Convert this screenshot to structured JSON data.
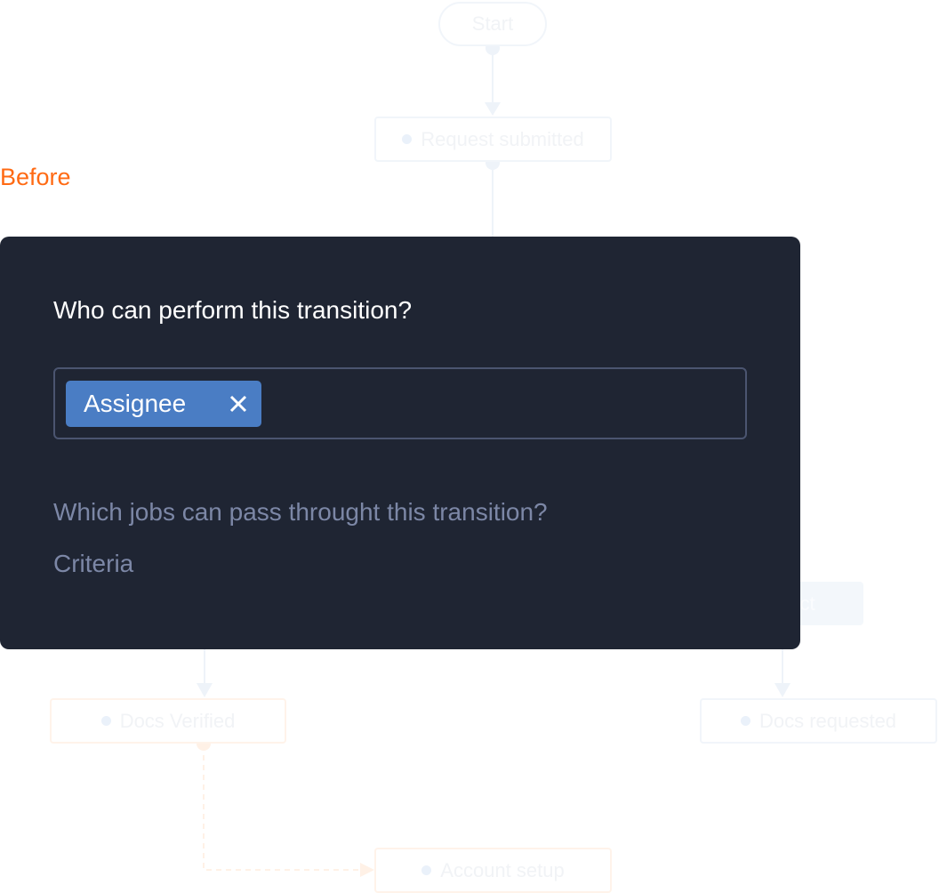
{
  "section_label": "Before",
  "flow": {
    "nodes": {
      "start": "Start",
      "request_submitted": "Request submitted",
      "reject": "Reject",
      "docs_verified": "Docs Verified",
      "docs_requested": "Docs requested",
      "account_setup": "Account setup"
    }
  },
  "panel": {
    "question_performers": "Who can perform this transition?",
    "selected_tags": [
      {
        "label": "Assignee",
        "remove_icon": "close-icon"
      }
    ],
    "question_jobs": "Which jobs can pass throught this transition?",
    "criteria_label": "Criteria"
  },
  "colors": {
    "accent": "#ff6a13",
    "panel_bg": "#1f2533",
    "tag_bg": "#4a7dc4",
    "muted_text": "#7c87a6"
  }
}
